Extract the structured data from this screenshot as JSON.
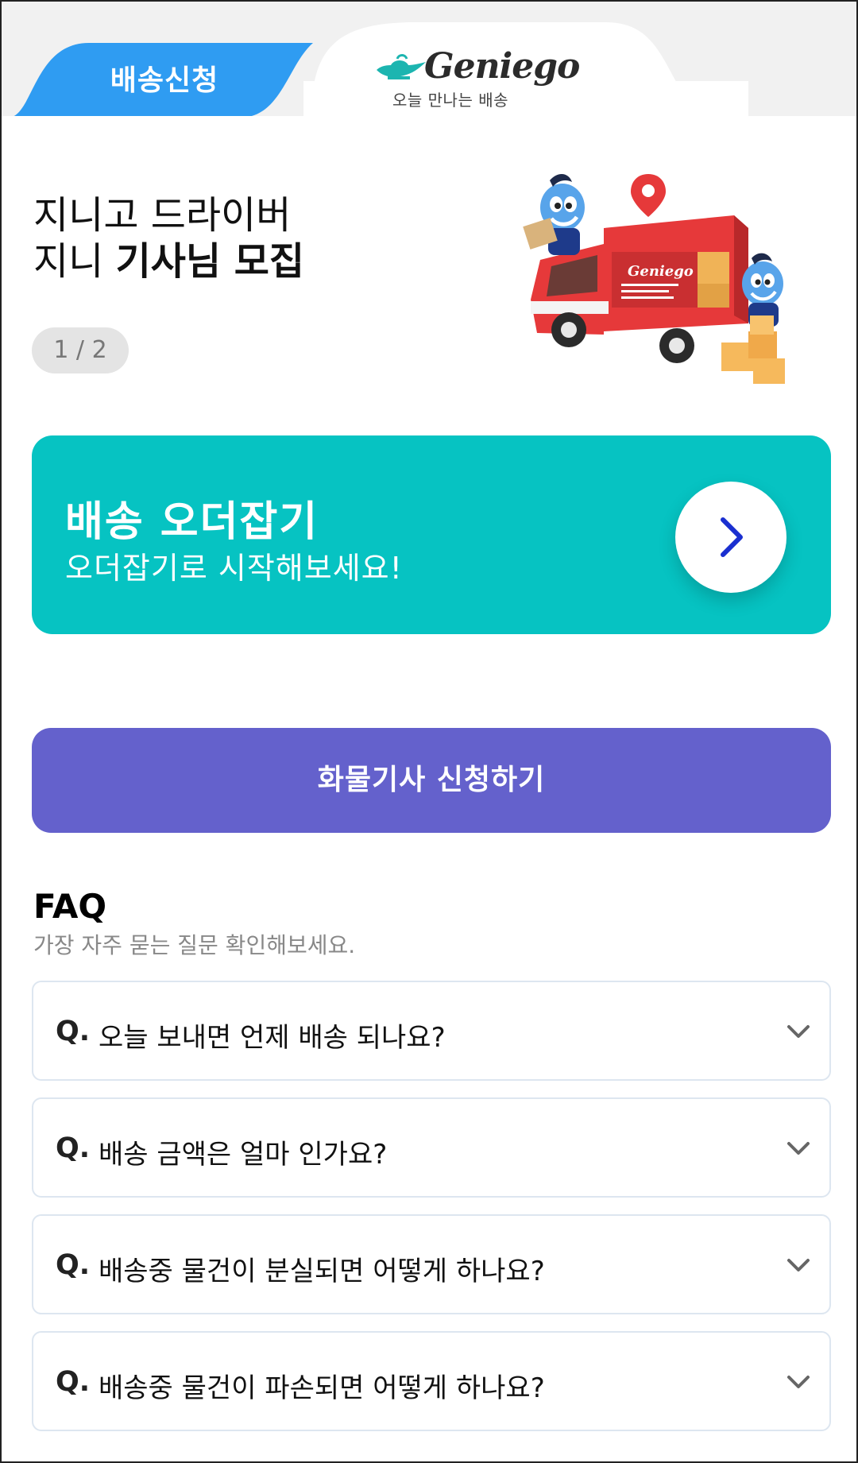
{
  "header": {
    "tab_label": "배송신청",
    "logo_word": "Geniego",
    "logo_tagline": "오늘 만나는 배송"
  },
  "banner": {
    "line1": "지니고 드라이버",
    "line2_plain": "지니 ",
    "line2_bold": "기사님 모집",
    "pager": "1 / 2",
    "truck_logo": "Geniego"
  },
  "order_card": {
    "title": "배송 오더잡기",
    "subtitle": "오더잡기로 시작해보세요!",
    "arrow_icon": "chevron-right-icon"
  },
  "apply_button": {
    "label": "화물기사 신청하기"
  },
  "faq": {
    "title": "FAQ",
    "subtitle": "가장 자주 묻는 질문 확인해보세요.",
    "q_prefix": "Q.",
    "items": [
      {
        "question": "오늘 보내면 언제 배송 되나요?"
      },
      {
        "question": "배송 금액은 얼마 인가요?"
      },
      {
        "question": "배송중 물건이 분실되면 어떻게 하나요?"
      },
      {
        "question": "배송중 물건이 파손되면 어떻게 하나요?"
      }
    ]
  },
  "colors": {
    "tab_blue": "#2f9cf2",
    "order_teal": "#06c3c2",
    "apply_purple": "#6461cc",
    "arrow_blue": "#1a2fd0",
    "truck_red": "#e6393a"
  }
}
